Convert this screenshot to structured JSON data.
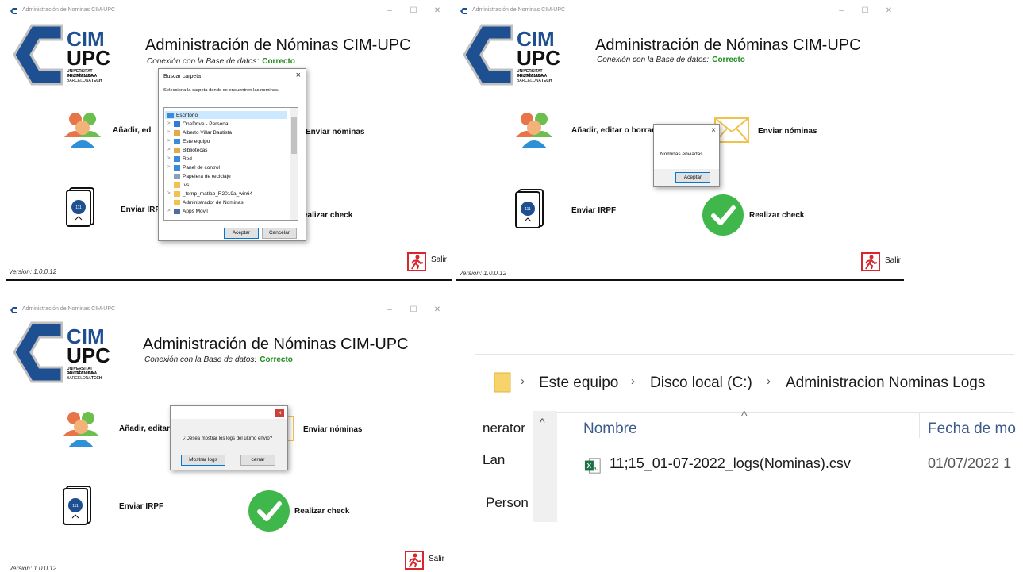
{
  "app": {
    "window_title": "Administración de Nominas CIM-UPC",
    "title": "Administración de Nóminas CIM-UPC",
    "connection_label": "Conexión con la Base de datos:",
    "connection_status": "Correcto",
    "version": "Version: 1.0.0.12",
    "logo": {
      "line1": "CIM",
      "line2": "UPC",
      "sub1": "UNIVERSITAT POLITÈCNICA",
      "sub2": "DE CATALUNYA",
      "sub3a": "BARCELONA",
      "sub3b": "TECH"
    },
    "colors": {
      "status_green": "#1e8c1e",
      "logo_blue": "#1d4f91",
      "exit_red": "#d9262c"
    }
  },
  "panel1": {
    "labels": {
      "add": "Añadir, ed",
      "irpf": "Enviar IRP",
      "send": "Enviar nóminas",
      "check": "ealizar check",
      "exit": "Salir"
    },
    "dialog": {
      "title": "Buscar carpeta",
      "close": "×",
      "instruction": "Selecciona la carpeta donde se encuentren las nominas.",
      "tree": [
        {
          "label": "Escritorio",
          "arrow": "",
          "icon": "desktop-icon",
          "color": "#3b8bd9"
        },
        {
          "label": "OneDrive - Personal",
          "arrow": ">",
          "icon": "cloud-icon",
          "color": "#2f7bd6"
        },
        {
          "label": "Alberto Villar Bautista",
          "arrow": ">",
          "icon": "user-icon",
          "color": "#e3a94b"
        },
        {
          "label": "Este equipo",
          "arrow": ">",
          "icon": "computer-icon",
          "color": "#3b8bd9"
        },
        {
          "label": "Bibliotecas",
          "arrow": ">",
          "icon": "library-icon",
          "color": "#e3a94b"
        },
        {
          "label": "Red",
          "arrow": ">",
          "icon": "network-icon",
          "color": "#3b8bd9"
        },
        {
          "label": "Panel de control",
          "arrow": ">",
          "icon": "control-panel-icon",
          "color": "#3b8bd9"
        },
        {
          "label": "Papelera de reciclaje",
          "arrow": "",
          "icon": "recycle-bin-icon",
          "color": "#8aa0b8"
        },
        {
          "label": ".vs",
          "arrow": "",
          "icon": "folder-icon",
          "color": "#f2c14e"
        },
        {
          "label": "_temp_matlab_R2019a_win64",
          "arrow": ">",
          "icon": "folder-icon",
          "color": "#f2c14e"
        },
        {
          "label": "Administrador de Nominas",
          "arrow": "",
          "icon": "folder-icon",
          "color": "#f2c14e"
        },
        {
          "label": "Apps Movil",
          "arrow": ">",
          "icon": "folder-icon",
          "color": "#4a6fa5"
        }
      ],
      "ok": "Aceptar",
      "cancel": "Cancelar"
    }
  },
  "panel2": {
    "labels": {
      "add": "Añadir, editar o borrar",
      "send": "Enviar nóminas",
      "irpf": "Enviar IRPF",
      "check": "Realizar check",
      "exit": "Salir"
    },
    "dialog": {
      "close": "×",
      "message": "Nominas enviadas.",
      "ok": "Aceptar"
    }
  },
  "panel3": {
    "labels": {
      "add": "Añadir, editar",
      "send": "Enviar nóminas",
      "irpf": "Enviar IRPF",
      "check": "Realizar check",
      "exit": "Salir"
    },
    "dialog": {
      "close": "×",
      "message": "¿Desea mostrar los logs del último envío?",
      "show": "Mostrar logs",
      "cancel": "cerrar"
    }
  },
  "explorer": {
    "breadcrumb": [
      "Este equipo",
      "Disco local (C:)",
      "Administracion Nominas Logs"
    ],
    "separator": "›",
    "sidebar": [
      "nerator",
      "Lan",
      "Person"
    ],
    "columns": {
      "name": "Nombre",
      "date": "Fecha de mo"
    },
    "sort_glyph": "^",
    "file": {
      "name": "11;15_01-07-2022_logs(Nominas).csv",
      "date": "01/07/2022 1"
    }
  }
}
